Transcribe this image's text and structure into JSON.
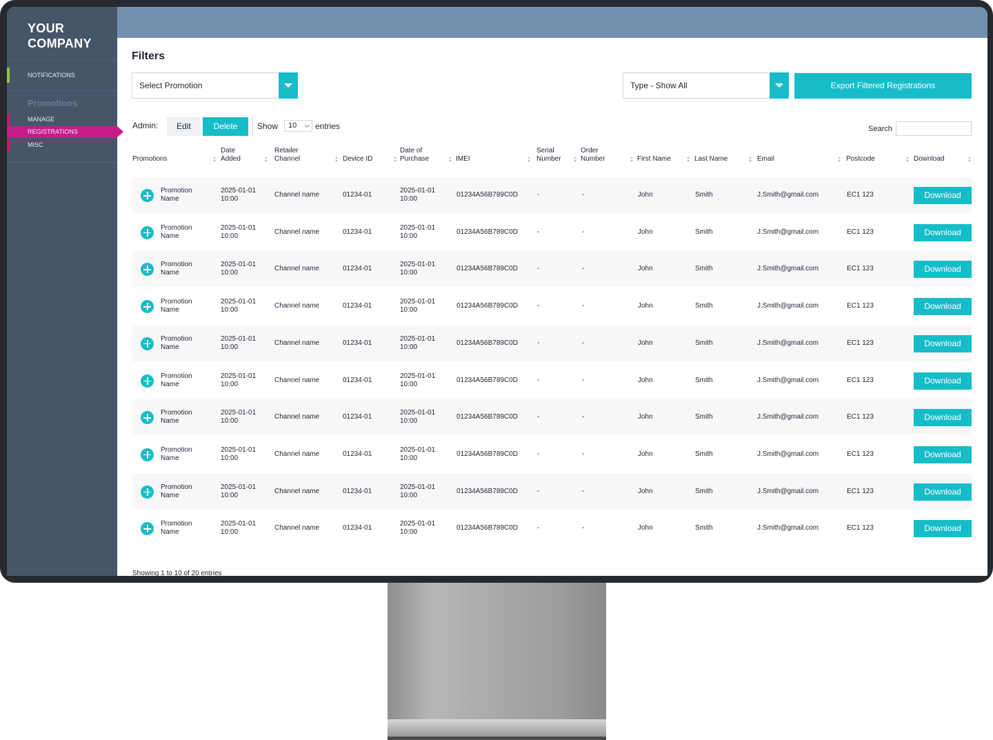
{
  "sidebar": {
    "brand_line1": "YOUR",
    "brand_line2": "COMPANY",
    "notifications": "NOTIFICATIONS",
    "section": "Promotions",
    "items": [
      {
        "label": "MANAGE"
      },
      {
        "label": "REGISTRATIONS"
      },
      {
        "label": "MISC"
      }
    ]
  },
  "filters": {
    "title": "Filters",
    "promotion_select": "Select Promotion",
    "type_select": "Type - Show All",
    "export_label": "Export Filtered Registrations"
  },
  "toolbar": {
    "admin_label": "Admin:",
    "edit_label": "Edit",
    "delete_label": "Delete",
    "show_label": "Show",
    "entries_value": "10",
    "entries_label": "entries",
    "search_label": "Search",
    "search_value": ""
  },
  "table": {
    "headers": {
      "promotions": "Promotions",
      "date_added_1": "Date",
      "date_added_2": "Added",
      "retailer_1": "Retailer",
      "retailer_2": "Channel",
      "device_id": "Device ID",
      "purchase_1": "Date of",
      "purchase_2": "Purchase",
      "imei": "IMEI",
      "serial_1": "Serial",
      "serial_2": "Number",
      "order_1": "Order",
      "order_2": "Number",
      "first_name": "First Name",
      "last_name": "Last Name",
      "email": "Email",
      "postcode": "Postcode",
      "download": "Download"
    },
    "rows": [
      {
        "promo_1": "Promotion",
        "promo_2": "Name",
        "added_1": "2025-01-01",
        "added_2": "10:00",
        "channel": "Channel name",
        "device": "01234-01",
        "purchase_1": "2025-01-01",
        "purchase_2": "10:00",
        "imei": "01234A56B789C0D",
        "serial": "-",
        "order": "-",
        "first": "John",
        "last": "Smith",
        "email": "J.Smith@gmail.com",
        "postcode": "EC1 123",
        "download": "Download"
      },
      {
        "promo_1": "Promotion",
        "promo_2": "Name",
        "added_1": "2025-01-01",
        "added_2": "10:00",
        "channel": "Channel name",
        "device": "01234-01",
        "purchase_1": "2025-01-01",
        "purchase_2": "10:00",
        "imei": "01234A56B789C0D",
        "serial": "-",
        "order": "-",
        "first": "John",
        "last": "Smith",
        "email": "J.Smith@gmail.com",
        "postcode": "EC1 123",
        "download": "Download"
      },
      {
        "promo_1": "Promotion",
        "promo_2": "Name",
        "added_1": "2025-01-01",
        "added_2": "10:00",
        "channel": "Channel name",
        "device": "01234-01",
        "purchase_1": "2025-01-01",
        "purchase_2": "10:00",
        "imei": "01234A56B789C0D",
        "serial": "-",
        "order": "-",
        "first": "John",
        "last": "Smith",
        "email": "J.Smith@gmail.com",
        "postcode": "EC1 123",
        "download": "Download"
      },
      {
        "promo_1": "Promotion",
        "promo_2": "Name",
        "added_1": "2025-01-01",
        "added_2": "10:00",
        "channel": "Channel name",
        "device": "01234-01",
        "purchase_1": "2025-01-01",
        "purchase_2": "10:00",
        "imei": "01234A56B789C0D",
        "serial": "-",
        "order": "-",
        "first": "John",
        "last": "Smith",
        "email": "J.Smith@gmail.com",
        "postcode": "EC1 123",
        "download": "Download"
      },
      {
        "promo_1": "Promotion",
        "promo_2": "Name",
        "added_1": "2025-01-01",
        "added_2": "10:00",
        "channel": "Channel name",
        "device": "01234-01",
        "purchase_1": "2025-01-01",
        "purchase_2": "10:00",
        "imei": "01234A56B789C0D",
        "serial": "-",
        "order": "-",
        "first": "John",
        "last": "Smith",
        "email": "J.Smith@gmail.com",
        "postcode": "EC1 123",
        "download": "Download"
      },
      {
        "promo_1": "Promotion",
        "promo_2": "Name",
        "added_1": "2025-01-01",
        "added_2": "10:00",
        "channel": "Channel name",
        "device": "01234-01",
        "purchase_1": "2025-01-01",
        "purchase_2": "10:00",
        "imei": "01234A56B789C0D",
        "serial": "-",
        "order": "-",
        "first": "John",
        "last": "Smith",
        "email": "J.Smith@gmail.com",
        "postcode": "EC1 123",
        "download": "Download"
      },
      {
        "promo_1": "Promotion",
        "promo_2": "Name",
        "added_1": "2025-01-01",
        "added_2": "10:00",
        "channel": "Channel name",
        "device": "01234-01",
        "purchase_1": "2025-01-01",
        "purchase_2": "10:00",
        "imei": "01234A56B789C0D",
        "serial": "-",
        "order": "-",
        "first": "John",
        "last": "Smith",
        "email": "J.Smith@gmail.com",
        "postcode": "EC1 123",
        "download": "Download"
      },
      {
        "promo_1": "Promotion",
        "promo_2": "Name",
        "added_1": "2025-01-01",
        "added_2": "10:00",
        "channel": "Channel name",
        "device": "01234-01",
        "purchase_1": "2025-01-01",
        "purchase_2": "10:00",
        "imei": "01234A56B789C0D",
        "serial": "-",
        "order": "-",
        "first": "John",
        "last": "Smith",
        "email": "J.Smith@gmail.com",
        "postcode": "EC1 123",
        "download": "Download"
      },
      {
        "promo_1": "Promotion",
        "promo_2": "Name",
        "added_1": "2025-01-01",
        "added_2": "10:00",
        "channel": "Channel name",
        "device": "01234-01",
        "purchase_1": "2025-01-01",
        "purchase_2": "10:00",
        "imei": "01234A56B789C0D",
        "serial": "-",
        "order": "-",
        "first": "John",
        "last": "Smith",
        "email": "J.Smith@gmail.com",
        "postcode": "EC1 123",
        "download": "Download"
      },
      {
        "promo_1": "Promotion",
        "promo_2": "Name",
        "added_1": "2025-01-01",
        "added_2": "10:00",
        "channel": "Channel name",
        "device": "01234-01",
        "purchase_1": "2025-01-01",
        "purchase_2": "10:00",
        "imei": "01234A56B789C0D",
        "serial": "-",
        "order": "-",
        "first": "John",
        "last": "Smith",
        "email": "J.Smith@gmail.com",
        "postcode": "EC1 123",
        "download": "Download"
      }
    ]
  },
  "footer": {
    "info": "Showing 1 to 10 of 20 entries"
  },
  "colors": {
    "accent": "#16bdc9",
    "sidebar": "#465568",
    "topbar": "#7490b0",
    "active_nav": "#c81b8a",
    "notification_marker": "#8dc63f"
  }
}
